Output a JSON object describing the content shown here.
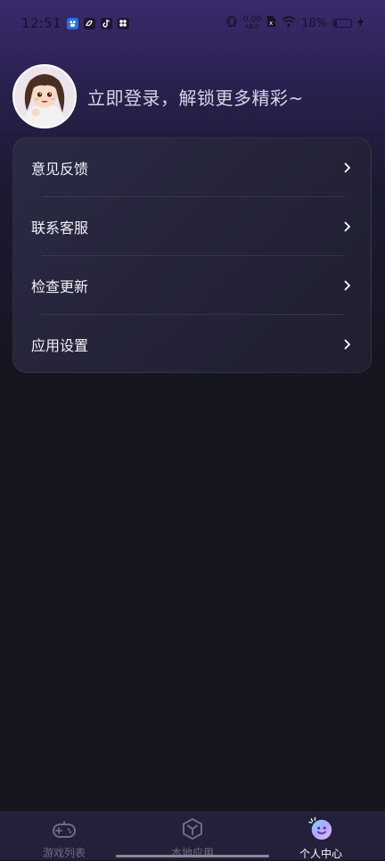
{
  "status_bar": {
    "time": "12:51",
    "net_speed_value": "0.00",
    "net_speed_unit": "KB/S",
    "battery_percent": "18%",
    "battery_level": 0.18,
    "icons": [
      "baidu-icon",
      "swirl-icon",
      "tiktok-icon",
      "app-grid-icon",
      "vibrate-icon",
      "sim-icon",
      "wifi-icon",
      "battery-icon",
      "charging-icon"
    ]
  },
  "profile": {
    "login_prompt": "立即登录，解锁更多精彩~",
    "avatar": "avatar-girl-illustration"
  },
  "menu": {
    "items": [
      {
        "label": "意见反馈",
        "icon": "chevron-right-icon"
      },
      {
        "label": "联系客服",
        "icon": "chevron-right-icon"
      },
      {
        "label": "检查更新",
        "icon": "chevron-right-icon"
      },
      {
        "label": "应用设置",
        "icon": "chevron-right-icon"
      }
    ]
  },
  "bottom_nav": {
    "items": [
      {
        "label": "游戏列表",
        "icon": "gamepad-icon",
        "active": false
      },
      {
        "label": "本地应用",
        "icon": "cube-icon",
        "active": false
      },
      {
        "label": "个人中心",
        "icon": "smiley-icon",
        "active": true
      }
    ]
  },
  "colors": {
    "accent": "#9b8cff",
    "background": "#15161f",
    "header_gradient_top": "#3a2a6c",
    "card": "#272640",
    "nav_inactive": "#6f6c83",
    "nav_active": "#ffffff"
  }
}
